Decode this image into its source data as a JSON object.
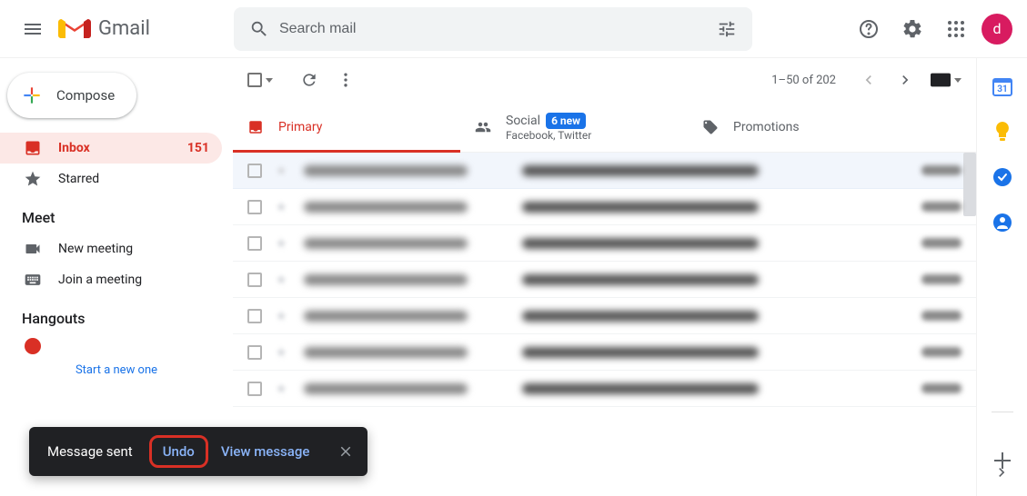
{
  "header": {
    "product_name": "Gmail",
    "search_placeholder": "Search mail",
    "avatar_letter": "d"
  },
  "sidebar": {
    "compose_label": "Compose",
    "items": [
      {
        "label": "Inbox",
        "count": "151"
      },
      {
        "label": "Starred"
      }
    ],
    "meet_heading": "Meet",
    "meet_items": [
      {
        "label": "New meeting"
      },
      {
        "label": "Join a meeting"
      }
    ],
    "hangouts_heading": "Hangouts",
    "start_new": "Start a new one"
  },
  "toolbar": {
    "page_range": "1–50 of 202"
  },
  "tabs": {
    "primary": "Primary",
    "social": "Social",
    "social_badge": "6 new",
    "social_sub": "Facebook, Twitter",
    "promotions": "Promotions"
  },
  "toast": {
    "message": "Message sent",
    "undo": "Undo",
    "view": "View message"
  },
  "rail": {
    "calendar_date": "31"
  }
}
